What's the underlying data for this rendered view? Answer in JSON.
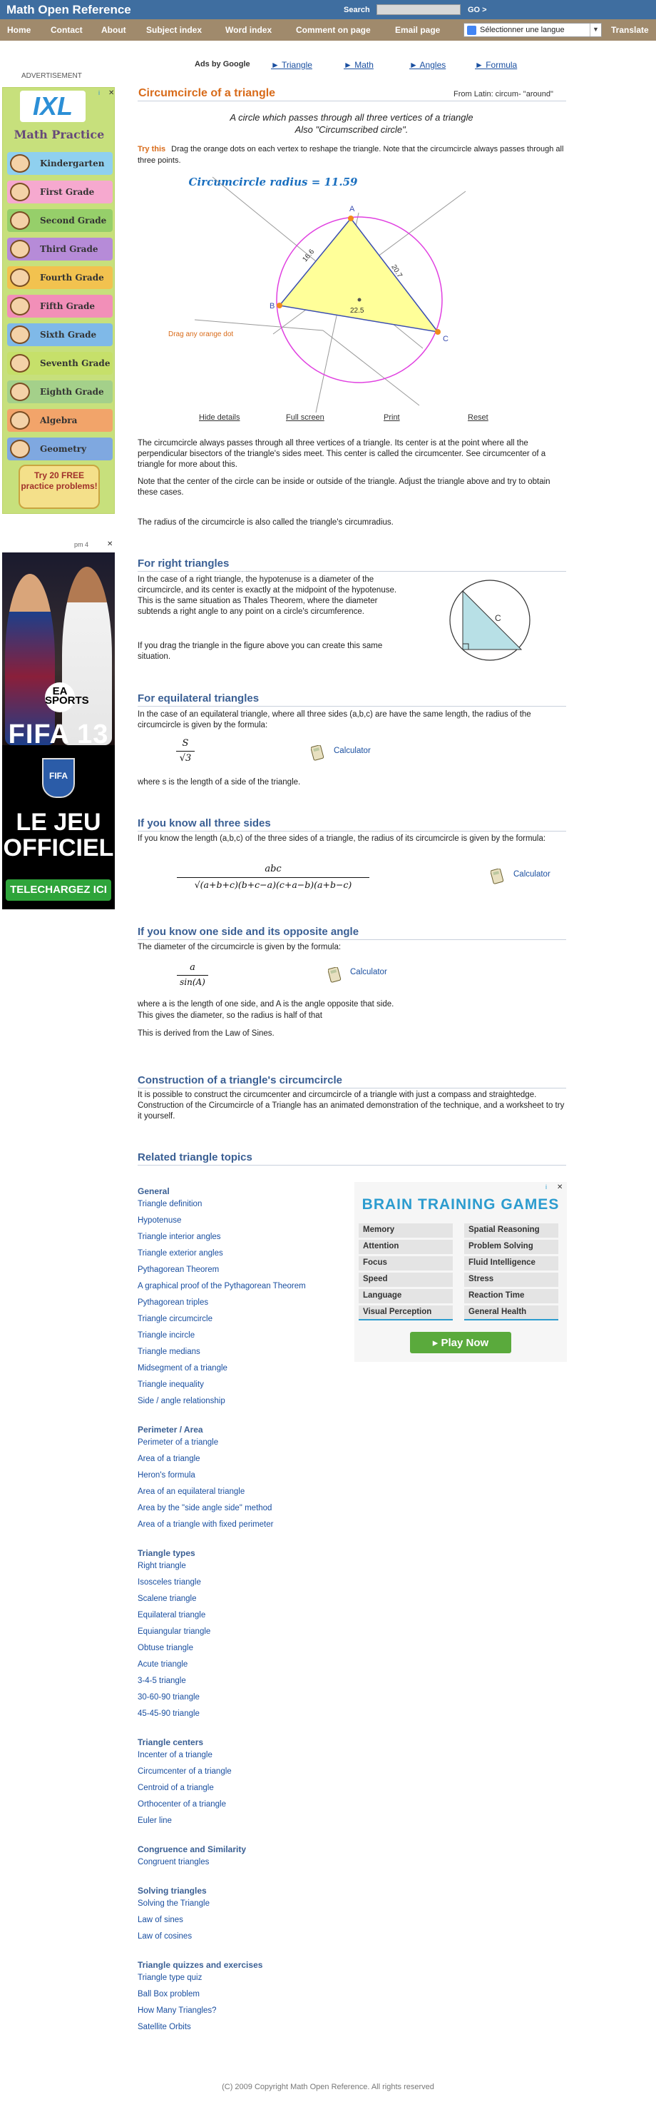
{
  "header": {
    "site_title": "Math Open Reference",
    "search_label": "Search",
    "search_value": "",
    "go_label": "GO >"
  },
  "nav": {
    "items": [
      "Home",
      "Contact",
      "About",
      "Subject index",
      "Word index",
      "Comment on page",
      "Email page"
    ],
    "language_select": "Sélectionner une langue",
    "translate": "Translate"
  },
  "ads": {
    "label": "ADVERTISEMENT",
    "ixl": {
      "logo": "IXL",
      "title": "Math Practice",
      "grades": [
        "Kindergarten",
        "First Grade",
        "Second Grade",
        "Third Grade",
        "Fourth Grade",
        "Fifth Grade",
        "Sixth Grade",
        "Seventh Grade",
        "Eighth Grade",
        "Algebra",
        "Geometry"
      ],
      "grade_colors": [
        "#8fd0ef",
        "#f6a9cf",
        "#96cf6a",
        "#b68bd8",
        "#f2c24f",
        "#f28fb8",
        "#7fb9e8",
        "#c6e06a",
        "#a4d08a",
        "#f2a46a",
        "#7fa8e0"
      ],
      "promo": "Try 20 FREE practice problems!",
      "info": "i",
      "close": "✕"
    },
    "fifa": {
      "info": "pm 4",
      "close": "✕",
      "brand": "EA SPORTS",
      "title": "FIFA 13",
      "badge": "FIFA",
      "slogan": "LE JEU OFFICIEL",
      "cta": "TELECHARGEZ ICI"
    }
  },
  "toplinks": [
    "Ads by Google",
    "► Triangle",
    "► Math",
    "► Angles",
    "► Formula"
  ],
  "page": {
    "title": "Circumcircle of a triangle",
    "latin": "From Latin: circum- \"around\"",
    "intro_line1": "A circle which passes through all three vertices of a triangle",
    "intro_line2": "Also \"Circumscribed circle\".",
    "try_label": "Try this",
    "try_text": "Drag the orange dots on each vertex to reshape the triangle. Note that the circumcircle always passes through all three points."
  },
  "applet": {
    "radius_text": "Circumcircle radius = 11.59",
    "drag_hint": "Drag any orange dot",
    "vertex_labels": [
      "A",
      "B",
      "C"
    ],
    "side_labels": [
      "16.6",
      "20.7",
      "22.5"
    ],
    "buttons": [
      "Hide details",
      "Full screen",
      "Print",
      "Reset"
    ]
  },
  "body": {
    "p1": "The circumcircle always passes through all three vertices of a triangle. Its center is at the point where all the perpendicular bisectors of the triangle's sides meet. This center is called the circumcenter. See circumcenter of a triangle for more about this.",
    "p2": "Note that the center of the circle can be inside or outside of the triangle. Adjust the triangle above and try to obtain these cases.",
    "p3": "The radius of the circumcircle is also called the triangle's circumradius.",
    "right_head": "For right triangles",
    "right_p1": "In the case of a right triangle, the hypotenuse is a diameter of the circumcircle, and its center is exactly at the midpoint of the hypotenuse. This is the same situation as Thales Theorem, where the diameter subtends a right angle to any point on a circle's circumference.",
    "right_p2": "If you drag the triangle in the figure above you can create this same situation.",
    "right_fig_label": "C",
    "equi_head": "For equilateral triangles",
    "equi_p1": "In the case of an equilateral triangle, where all three sides (a,b,c) are have the same length, the radius of the circumcircle is given by the formula:",
    "equi_num": "S",
    "equi_den": "√3",
    "equi_p2": "where s is the length of a side of the triangle.",
    "three_head": "If you know all three sides",
    "three_p1": "If you know the length (a,b,c) of the three sides of a triangle, the radius of its circumcircle is given by the formula:",
    "three_num": "abc",
    "three_den": "√(a+b+c)(b+c−a)(c+a−b)(a+b−c)",
    "one_head": "If you know one side and its opposite angle",
    "one_p1": "The diameter of the circumcircle is given by the formula:",
    "one_num": "a",
    "one_den": "sin(A)",
    "one_p2": "where a is the length of one side, and A is the angle opposite that side.",
    "one_p3": "This gives the diameter, so the radius is half of that",
    "one_p4": "This is derived from the Law of Sines.",
    "const_head": "Construction of a triangle's circumcircle",
    "const_p1": "It is possible to construct the circumcenter and circumcircle of a triangle with just a compass and straightedge. Construction of the Circumcircle of a Triangle has an animated demonstration of the technique, and a worksheet to try it yourself.",
    "calculator": "Calculator",
    "related_head": "Related triangle topics"
  },
  "related": [
    {
      "head": "General",
      "items": [
        "Triangle definition",
        "Hypotenuse",
        "Triangle interior angles",
        "Triangle exterior angles",
        "Pythagorean Theorem",
        "A graphical proof of the Pythagorean Theorem",
        "Pythagorean triples",
        "Triangle circumcircle",
        "Triangle incircle",
        "Triangle medians",
        "Midsegment of a triangle",
        "Triangle inequality",
        "Side / angle relationship"
      ]
    },
    {
      "head": "Perimeter / Area",
      "items": [
        "Perimeter of a triangle",
        "Area of a triangle",
        "Heron's formula",
        "Area of an equilateral triangle",
        "Area by the \"side angle side\" method",
        "Area of a triangle with fixed perimeter"
      ]
    },
    {
      "head": "Triangle types",
      "items": [
        "Right triangle",
        "Isosceles triangle",
        "Scalene triangle",
        "Equilateral triangle",
        "Equiangular triangle",
        "Obtuse triangle",
        "Acute triangle",
        "3-4-5 triangle",
        "30-60-90 triangle",
        "45-45-90 triangle"
      ]
    },
    {
      "head": "Triangle centers",
      "items": [
        "Incenter of a triangle",
        "Circumcenter of a triangle",
        "Centroid of a triangle",
        "Orthocenter of a triangle",
        "Euler line"
      ]
    },
    {
      "head": "Congruence and Similarity",
      "items": [
        "Congruent triangles"
      ]
    },
    {
      "head": "Solving triangles",
      "items": [
        "Solving the Triangle",
        "Law of sines",
        "Law of cosines"
      ]
    },
    {
      "head": "Triangle quizzes and exercises",
      "items": [
        "Triangle type quiz",
        "Ball Box problem",
        "How Many Triangles?",
        "Satellite Orbits"
      ]
    }
  ],
  "brain_ad": {
    "title": "BRAIN TRAINING GAMES",
    "left": [
      "Memory",
      "Attention",
      "Focus",
      "Speed",
      "Language",
      "Visual Perception"
    ],
    "right": [
      "Spatial Reasoning",
      "Problem Solving",
      "Fluid Intelligence",
      "Stress",
      "Reaction Time",
      "General Health"
    ],
    "cta": "Play Now",
    "info": "i",
    "close": "✕"
  },
  "footer": "(C) 2009 Copyright Math Open Reference. All rights reserved",
  "colors": {
    "header": "#3f6ea0",
    "nav": "#a08a6c",
    "title_orange": "#d86b1a",
    "heading_blue": "#3a5f94",
    "triangle_fill": "#ffff99",
    "circle": "#e040e0"
  }
}
